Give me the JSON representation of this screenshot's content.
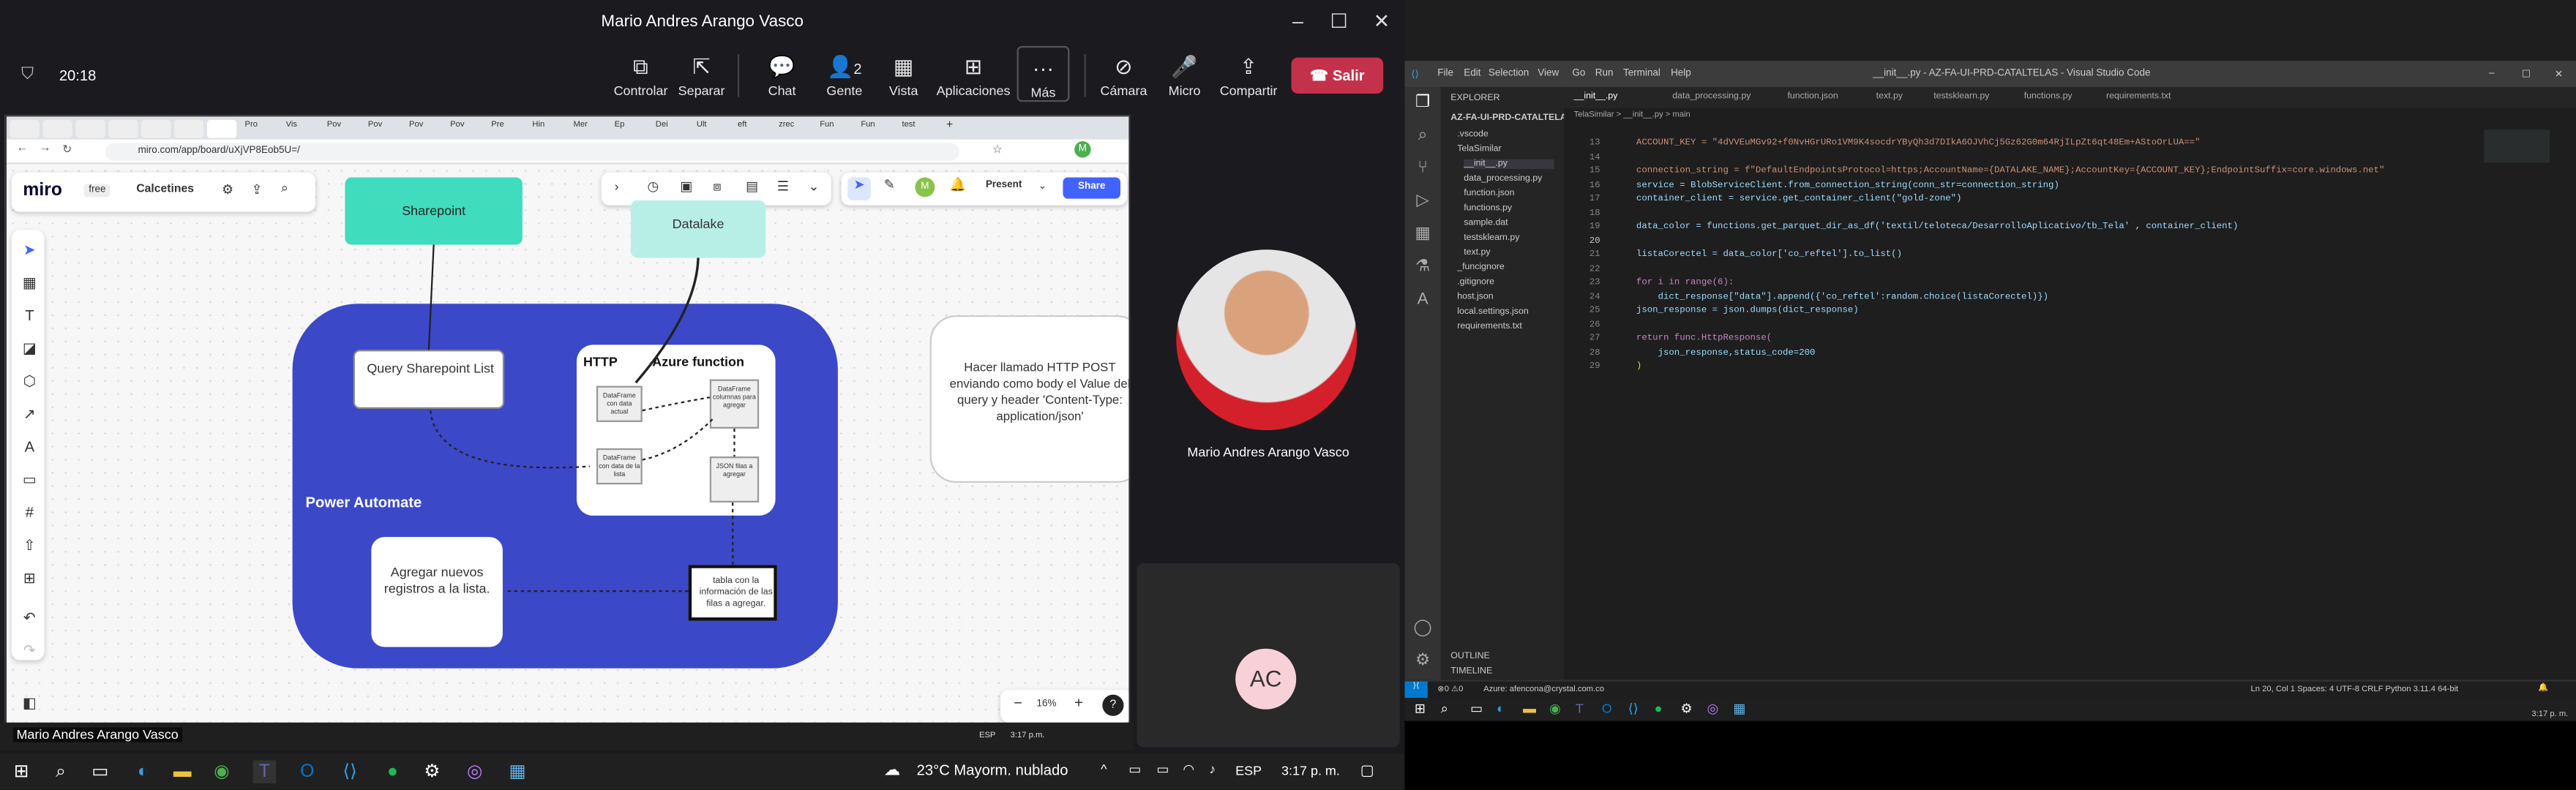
{
  "teams": {
    "window_title": "Mario Andres Arango Vasco",
    "timer": "20:18",
    "controls": [
      {
        "label": "Controlar",
        "icon": "control-icon"
      },
      {
        "label": "Separar",
        "icon": "pop-out-icon"
      },
      {
        "label": "Chat",
        "icon": "chat-icon"
      },
      {
        "label": "Gente",
        "icon": "people-icon",
        "badge": "2"
      },
      {
        "label": "Vista",
        "icon": "view-icon"
      },
      {
        "label": "Aplicaciones",
        "icon": "apps-icon"
      },
      {
        "label": "Más",
        "icon": "more-icon"
      },
      {
        "label": "Cámara",
        "icon": "camera-off-icon"
      },
      {
        "label": "Micro",
        "icon": "mic-icon"
      },
      {
        "label": "Compartir",
        "icon": "share-icon"
      }
    ],
    "leave_label": "Salir",
    "presenter_tile_name": "Mario Andres Arango Vasco",
    "shared_screen_owner": "Mario Andres Arango Vasco",
    "other_participant_initials": "AC"
  },
  "browser": {
    "url": "miro.com/app/board/uXjVP8Eob5U=/",
    "tabs": [
      "Pro",
      "Vis",
      "Pov",
      "Pov",
      "Pov",
      "Pov",
      "Pre",
      "Hin",
      "Mer",
      "Ep",
      "Dei",
      "Ult",
      "eft",
      "zrec",
      "Fun",
      "Fun",
      "test"
    ]
  },
  "miro": {
    "logo": "miro",
    "plan": "free",
    "board_name": "Calcetines",
    "present_label": "Present",
    "share_label": "Share",
    "zoom": "16%",
    "zoom_minus": "−",
    "zoom_plus": "+",
    "help": "?",
    "avatar_initial": "M",
    "diagram": {
      "sharepoint": "Sharepoint",
      "datalake": "Datalake",
      "query_sharepoint": "Query Sharepoint List",
      "http": "HTTP",
      "azure_function": "Azure function",
      "power_automate": "Power Automate",
      "add_records": "Agregar nuevos registros a la lista.",
      "table_info": "tabla con la información de las filas a agregar.",
      "df_actual": "DataFrame con data actual",
      "df_lista": "DataFrame con data de la lista",
      "df_columnas": "DataFrame columnas para agregar",
      "json_filas": "JSON filas a agregar",
      "http_note": "Hacer llamado HTTP POST enviando como body el Value del query y header 'Content-Type: application/json'"
    }
  },
  "shared_taskbar": {
    "time": "3:17 p.m.",
    "lang": "ESP"
  },
  "windows": {
    "weather": "23°C  Mayorm. nublado",
    "lang": "ESP",
    "time": "3:17 p. m."
  },
  "vscode": {
    "title": "__init__.py - AZ-FA-UI-PRD-CATALTELAS - Visual Studio Code",
    "menu": [
      "File",
      "Edit",
      "Selection",
      "View",
      "Go",
      "Run",
      "Terminal",
      "Help"
    ],
    "explorer_label": "EXPLORER",
    "project": "AZ-FA-UI-PRD-CATALTELAS",
    "files": [
      ".vscode",
      "TelaSimilar",
      "__init__.py",
      "data_processing.py",
      "function.json",
      "functions.py",
      "sample.dat",
      "testsklearn.py",
      "text.py",
      "_funcignore",
      ".gitignore",
      "host.json",
      "local.settings.json",
      "requirements.txt"
    ],
    "outline": "OUTLINE",
    "timeline": "TIMELINE",
    "tabs": [
      "__init__.py",
      "data_processing.py",
      "function.json",
      "text.py",
      "testsklearn.py",
      "functions.py",
      "requirements.txt"
    ],
    "breadcrumb": "TelaSimilar > __init__.py > main",
    "code": [
      {
        "n": "13",
        "t": "ACCOUNT_KEY = \"4dVVEuMGv92+f0NvHGrURo1VM9K4socdrYByQh3d7DIkA6OJVhCj5Gz62G0m64RjILpZt6qt48Em+AStoOrLUA==\""
      },
      {
        "n": "14",
        "t": ""
      },
      {
        "n": "15",
        "t": "connection_string = f\"DefaultEndpointsProtocol=https;AccountName={DATALAKE_NAME};AccountKey={ACCOUNT_KEY};EndpointSuffix=core.windows.net\""
      },
      {
        "n": "16",
        "t": "service = BlobServiceClient.from_connection_string(conn_str=connection_string)"
      },
      {
        "n": "17",
        "t": "container_client = service.get_container_client(\"gold-zone\")"
      },
      {
        "n": "18",
        "t": ""
      },
      {
        "n": "19",
        "t": "data_color = functions.get_parquet_dir_as_df('textil/teloteca/DesarrolloAplicativo/tb_Tela' , container_client)"
      },
      {
        "n": "20",
        "t": ""
      },
      {
        "n": "21",
        "t": "listaCorectel = data_color['co_reftel'].to_list()"
      },
      {
        "n": "22",
        "t": ""
      },
      {
        "n": "23",
        "t": "for i in range(6):"
      },
      {
        "n": "24",
        "t": "    dict_response[\"data\"].append({'co_reftel':random.choice(listaCorectel)})"
      },
      {
        "n": "25",
        "t": "json_response = json.dumps(dict_response)"
      },
      {
        "n": "26",
        "t": ""
      },
      {
        "n": "27",
        "t": "return func.HttpResponse("
      },
      {
        "n": "28",
        "t": "    json_response,status_code=200"
      },
      {
        "n": "29",
        "t": ")"
      }
    ],
    "status_left": "Azure: afencona@crystal.com.co",
    "status_right": "Ln 20, Col 1   Spaces: 4   UTF-8   CRLF   Python   3.11.4 64-bit",
    "time": "3:17 p. m."
  }
}
